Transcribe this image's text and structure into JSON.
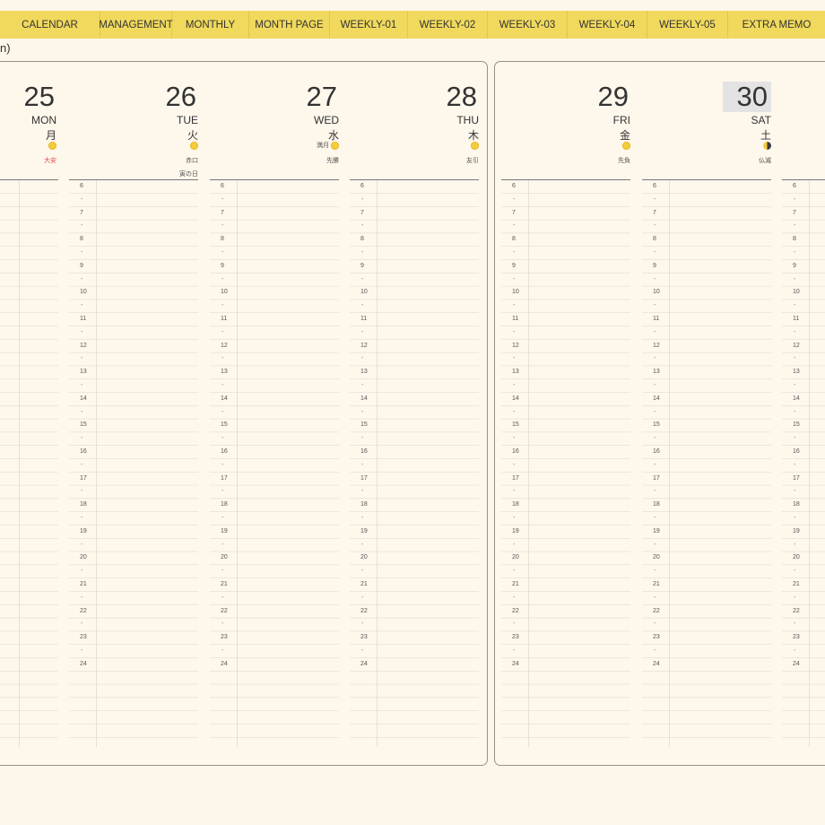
{
  "nav": {
    "tabs": [
      "CALENDAR",
      "MANAGEMENT",
      "MONTHLY",
      "MONTH PAGE",
      "WEEKLY-01",
      "WEEKLY-02",
      "WEEKLY-03",
      "WEEKLY-04",
      "WEEKLY-05",
      "EXTRA MEMO"
    ]
  },
  "header": {
    "partial_text": "n)"
  },
  "colors": {
    "tab_bar": "#f0d95c",
    "background": "#fdf6ea",
    "highlight_day": "#e3e3e3",
    "taian_red": "#e04848",
    "moon": "#f3cd3a"
  },
  "hours": [
    "6",
    "7",
    "8",
    "9",
    "10",
    "11",
    "12",
    "13",
    "14",
    "15",
    "16",
    "17",
    "18",
    "19",
    "20",
    "21",
    "22",
    "23",
    "24"
  ],
  "days": [
    {
      "num": "25",
      "en": "MON",
      "jp": "月",
      "moon_label": "",
      "moon": "full-moon-icon",
      "rokuyo": "大安",
      "extra": "",
      "highlight": false
    },
    {
      "num": "26",
      "en": "TUE",
      "jp": "火",
      "moon_label": "",
      "moon": "full-moon-icon",
      "rokuyo": "赤口",
      "extra": "寅の日",
      "highlight": false
    },
    {
      "num": "27",
      "en": "WED",
      "jp": "水",
      "moon_label": "満月",
      "moon": "full-moon-icon",
      "rokuyo": "先勝",
      "extra": "",
      "highlight": false
    },
    {
      "num": "28",
      "en": "THU",
      "jp": "木",
      "moon_label": "",
      "moon": "full-moon-icon",
      "rokuyo": "友引",
      "extra": "",
      "highlight": false
    },
    {
      "num": "29",
      "en": "FRI",
      "jp": "金",
      "moon_label": "",
      "moon": "full-moon-icon",
      "rokuyo": "先負",
      "extra": "",
      "highlight": false
    },
    {
      "num": "30",
      "en": "SAT",
      "jp": "土",
      "moon_label": "",
      "moon": "half-moon-icon",
      "rokuyo": "仏滅",
      "extra": "",
      "highlight": true
    }
  ]
}
